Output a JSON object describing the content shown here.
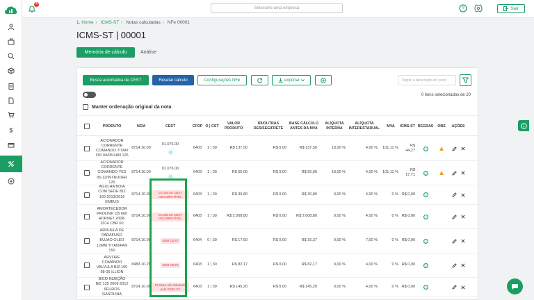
{
  "topbar": {
    "notification_count": "4",
    "company_placeholder": "Selecione uma empresa",
    "exit_label": "Sair"
  },
  "breadcrumb": [
    "Home",
    "ICMS-ST",
    "Notas calculadas",
    "NFe 00001"
  ],
  "page_title": "ICMS-ST | 00001",
  "tabs": {
    "active": "Memória de cálculo",
    "inactive": "Análise"
  },
  "toolbar": {
    "auto_cest": "Busca automática de CEST",
    "reset": "Resetar cálculo",
    "config": "Configurações NFe",
    "export": "exportar",
    "search_placeholder": "Digite a descrição do prod"
  },
  "selection_text": "0 itens selecionados de 20",
  "keep_order_label": "Manter ordenação original da nota",
  "columns": {
    "produto": "PRODUTO",
    "ncm": "NCM",
    "cest": "CEST",
    "cfop": "CFOP",
    "ocst": "O | CST",
    "valor_produto": "VALOR PRODUTO",
    "ipi": "IPI/OUTRAS DES/SEG/FRETE",
    "base": "BASE CÁLCULO ANTES DA MVA",
    "aliq_int": "ALÍQUOTA INTERNA",
    "aliq_inter": "ALÍQUOTA INTERESTADUAL",
    "mva": "MVA",
    "icms_st": "ICMS-ST",
    "regras": "REGRAS",
    "obs": "OBS",
    "acoes": "AÇÕES"
  },
  "rows": [
    {
      "produto": "ACIONADOR CORRENTE COMANDO TITAN 150 04/08 FAN 125",
      "ncm": "8714.10.00",
      "cest": "01.076.00",
      "cest_type": "code",
      "cfop": "6403",
      "ocst": "1 | 30",
      "valor": "R$ 137,50",
      "ipi": "R$ 0,00",
      "base": "R$ 137,50",
      "aliq_int": "18,00 %",
      "aliq_inter": "4,00 %",
      "mva": "101,11 %",
      "icms": "R$ 44,27",
      "warn": true
    },
    {
      "produto": "ACIONADOR CORRENTE COMANDO YES 05-12/INTRUDER 125",
      "ncm": "8714.10.00",
      "cest": "01.076.00",
      "cest_type": "code",
      "cfop": "6403",
      "ocst": "1 | 30",
      "valor": "R$ 55,00",
      "ipi": "R$ 0,00",
      "base": "R$ 55,00",
      "aliq_int": "18,00 %",
      "aliq_inter": "4,00 %",
      "mva": "101,11 %",
      "icms": "R$ 17,71",
      "warn": true
    },
    {
      "produto": "AGULHA BOIA COM SEDE BIZ 100 2013/2016 EMBUS",
      "ncm": "8714.10.00",
      "cest": "01.030.00 CEST INCOMPATÍVEL",
      "cest_type": "badge",
      "cfop": "6403",
      "ocst": "1 | 30",
      "valor": "R$ 30,80",
      "ipi": "R$ 0,00",
      "base": "R$ 30,80",
      "aliq_int": "0,00 %",
      "aliq_inter": "4,00 %",
      "mva": "0 %",
      "icms": "R$ 0,00",
      "warn": false
    },
    {
      "produto": "AMORTECEDOR PROLINK CB 600 HORNET 2008-2014 CBR 60",
      "ncm": "8714.10.00",
      "cest": "01.030.00 CEST INCOMPATÍVEL",
      "cest_type": "badge",
      "cfop": "6403",
      "ocst": "1 | 30",
      "valor": "R$ 2.008,80",
      "ipi": "R$ 0,00",
      "base": "R$ 2.008,80",
      "aliq_int": "0,00 %",
      "aliq_inter": "4,00 %",
      "mva": "0 %",
      "icms": "R$ 0,00",
      "warn": false
    },
    {
      "produto": "ARRUELA DE PARAFUSO BUJAO OLEO 12MM TITAN/FAN 150",
      "ncm": "8714.10.00",
      "cest": "SEM CEST",
      "cest_type": "badge",
      "cfop": "6404",
      "ocst": "0 | 30",
      "valor": "R$ 17,60",
      "ipi": "R$ 0,00",
      "base": "R$ 16,37",
      "aliq_int": "0,00 %",
      "aliq_inter": "7,00 %",
      "mva": "0 %",
      "icms": "R$ 0,00",
      "warn": false
    },
    {
      "produto": "ARVORE COMANDO VALVULA BIZ 100 98-05 ILLION",
      "ncm": "8483.10.20",
      "cest": "SEM CEST",
      "cest_type": "badge",
      "cfop": "6403",
      "ocst": "1 | 30",
      "valor": "R$ 82,17",
      "ipi": "R$ 0,00",
      "base": "R$ 82,17",
      "aliq_int": "0,00 %",
      "aliq_inter": "4,00 %",
      "mva": "0 %",
      "icms": "R$ 0,00",
      "warn": false
    },
    {
      "produto": "BICO INJEÇÃO BIZ 125 2009-2012 6FUROS GASOLINA",
      "ncm": "8714.10.00",
      "cest": "Produto não tributado pelo ICMS ST",
      "cest_type": "badge",
      "cfop": "6403",
      "ocst": "1 | 30",
      "valor": "R$ 145,20",
      "ipi": "R$ 0,00",
      "base": "R$ 145,20",
      "aliq_int": "0,00 %",
      "aliq_inter": "4,00 %",
      "mva": "0 %",
      "icms": "R$ 0,00",
      "warn": false
    }
  ],
  "colors": {
    "primary": "#1b9e63",
    "blue": "#2463a6",
    "alert": "#e53935",
    "highlight": "#1aa34a"
  }
}
